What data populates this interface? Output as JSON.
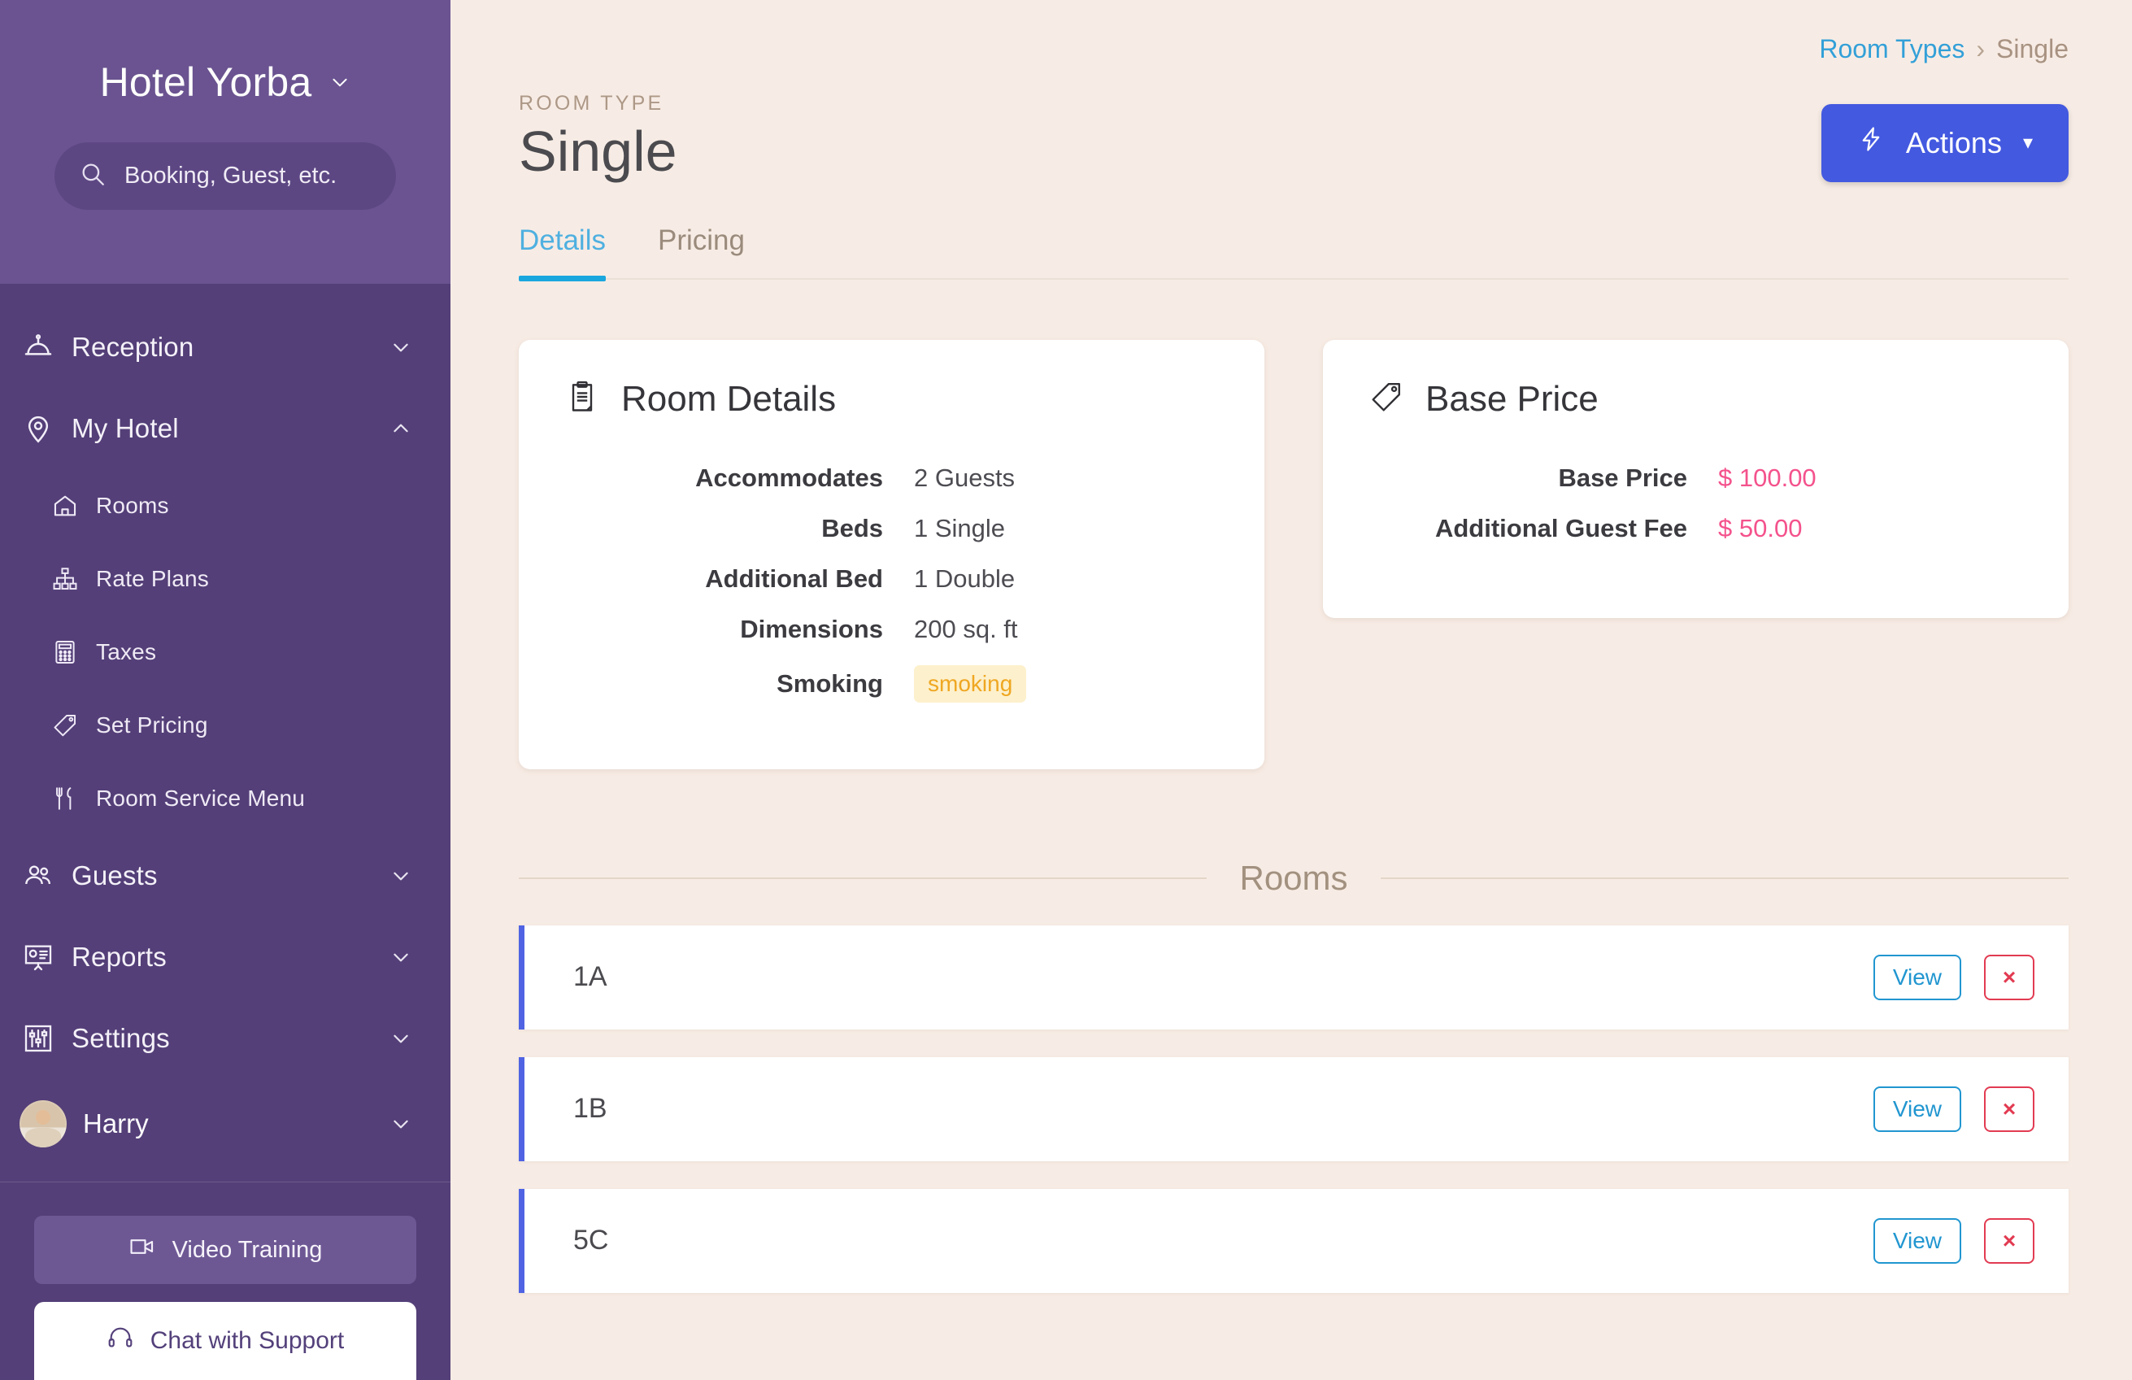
{
  "sidebar": {
    "hotel_name": "Hotel Yorba",
    "search": {
      "placeholder": "Booking, Guest, etc.",
      "value": ""
    },
    "nav": [
      {
        "label": "Reception",
        "icon": "bell-icon",
        "caret": "chevron-down-icon"
      },
      {
        "label": "My Hotel",
        "icon": "location-pin-icon",
        "caret": "chevron-up-icon"
      }
    ],
    "sub_items": [
      {
        "label": "Rooms",
        "icon": "house-icon"
      },
      {
        "label": "Rate Plans",
        "icon": "org-chart-icon"
      },
      {
        "label": "Taxes",
        "icon": "calculator-icon"
      },
      {
        "label": "Set Pricing",
        "icon": "price-tag-icon"
      },
      {
        "label": "Room Service Menu",
        "icon": "cutlery-icon"
      }
    ],
    "nav_lower": [
      {
        "label": "Guests",
        "icon": "people-icon",
        "caret": "chevron-down-icon"
      },
      {
        "label": "Reports",
        "icon": "presentation-chart-icon",
        "caret": "chevron-down-icon"
      },
      {
        "label": "Settings",
        "icon": "sliders-icon",
        "caret": "chevron-down-icon"
      }
    ],
    "user": {
      "name": "Harry",
      "caret": "chevron-down-icon"
    },
    "video_training": "Video Training",
    "chat_support": "Chat with Support"
  },
  "breadcrumb": {
    "parent": "Room Types",
    "separator": "›",
    "current": "Single"
  },
  "header": {
    "eyebrow": "ROOM TYPE",
    "title": "Single",
    "actions_label": "Actions",
    "actions_caret": "▾"
  },
  "tabs": [
    {
      "label": "Details",
      "active": true
    },
    {
      "label": "Pricing",
      "active": false
    }
  ],
  "cards": {
    "room_details": {
      "title": "Room Details",
      "icon": "clipboard-icon",
      "rows": [
        {
          "key": "Accommodates",
          "value": "2 Guests"
        },
        {
          "key": "Beds",
          "value": "1 Single"
        },
        {
          "key": "Additional Bed",
          "value": "1   Double"
        },
        {
          "key": "Dimensions",
          "value": "200 sq. ft"
        },
        {
          "key": "Smoking",
          "value": "smoking",
          "badge": true
        }
      ]
    },
    "base_price": {
      "title": "Base Price",
      "icon": "price-tag-icon",
      "rows": [
        {
          "key": "Base Price",
          "value": "$ 100.00"
        },
        {
          "key": "Additional Guest Fee",
          "value": "$ 50.00"
        }
      ]
    }
  },
  "rooms_section": {
    "label": "Rooms",
    "view_label": "View",
    "delete_label": "×",
    "rooms": [
      {
        "name": "1A"
      },
      {
        "name": "1B"
      },
      {
        "name": "5C"
      }
    ]
  },
  "colors": {
    "sidebar_bg": "#543f78",
    "sidebar_header_bg": "#6a5390",
    "page_bg": "#f7ece5",
    "accent_blue": "#4359e0",
    "link_blue": "#33a0d8",
    "tab_active": "#1aa7de",
    "price_pink": "#f4528c",
    "badge_amber": "#efa722",
    "badge_amber_bg": "#fdf0cc",
    "room_accent": "#4f63e3",
    "danger_red": "#e23b52"
  }
}
